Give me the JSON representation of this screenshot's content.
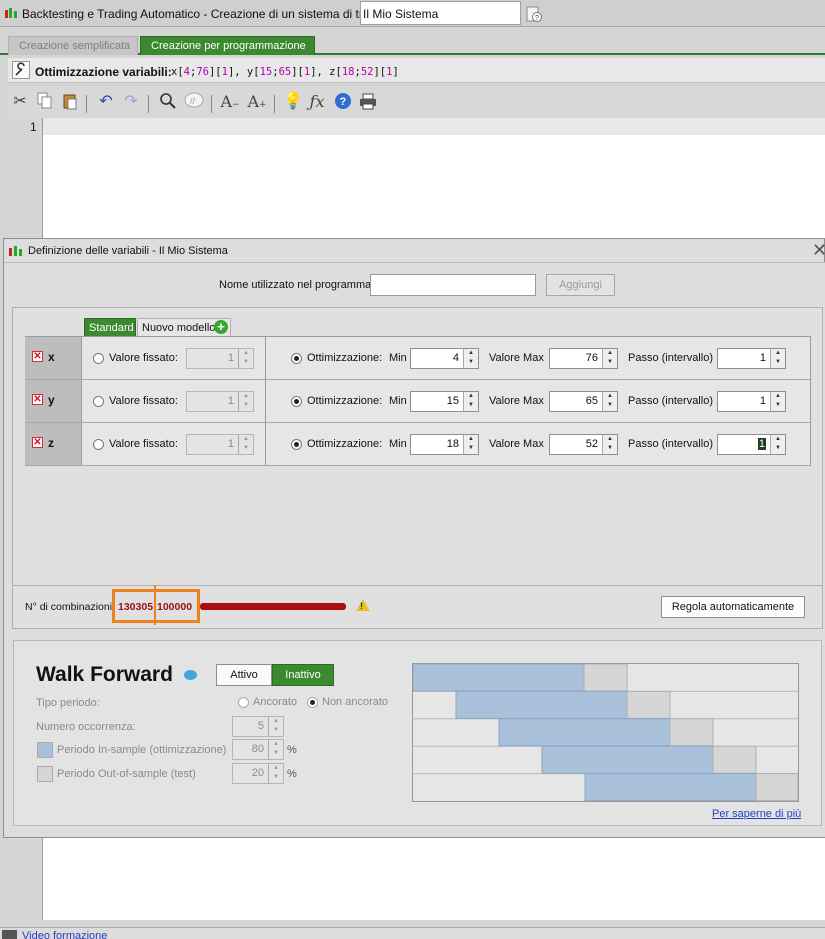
{
  "window": {
    "title": "Backtesting e Trading Automatico - Creazione di un sistema di trading",
    "system_name": "Il Mio Sistema"
  },
  "tabs": {
    "simple": "Creazione semplificata",
    "programming": "Creazione per programmazione"
  },
  "optimization": {
    "label": "Ottimizzazione variabili:",
    "vars": [
      {
        "name": "x",
        "min": "4",
        "max": "76",
        "step": "1"
      },
      {
        "name": "y",
        "min": "15",
        "max": "65",
        "step": "1"
      },
      {
        "name": "z",
        "min": "18",
        "max": "52",
        "step": "1"
      }
    ]
  },
  "editor": {
    "line_number": "1"
  },
  "dialog": {
    "title": "Definizione delle variabili - Il Mio Sistema",
    "name_label": "Nome utilizzato nel programma",
    "add_button": "Aggiungi",
    "tab_standard": "Standard",
    "tab_new_model": "Nuovo modello",
    "labels": {
      "fixed": "Valore fissato:",
      "optimization": "Ottimizzazione:",
      "min": "Min",
      "max": "Valore Max",
      "step": "Passo (intervallo)"
    },
    "rows": [
      {
        "name": "x",
        "fixed": "1",
        "min": "4",
        "max": "76",
        "step": "1"
      },
      {
        "name": "y",
        "fixed": "1",
        "min": "15",
        "max": "65",
        "step": "1"
      },
      {
        "name": "z",
        "fixed": "1",
        "min": "18",
        "max": "52",
        "step": "1"
      }
    ],
    "combinations_label": "N° di combinazioni",
    "combinations_value": "130305",
    "combinations_limit": "100000",
    "auto_button": "Regola automaticamente"
  },
  "walk_forward": {
    "title": "Walk Forward",
    "active": "Attivo",
    "inactive": "Inattivo",
    "period_type_label": "Tipo periodo:",
    "anchored": "Ancorato",
    "not_anchored": "Non ancorato",
    "occurrences_label": "Numero occorrenza:",
    "occurrences": "5",
    "in_sample_label": "Periodo In-sample (ottimizzazione)",
    "in_sample": "80",
    "out_sample_label": "Periodo Out-of-sample (test)",
    "out_sample": "20",
    "percent": "%",
    "learn_more": "Per saperne di più",
    "colors": {
      "in_sample": "#a9c1db",
      "out_sample": "#d6d6d6"
    }
  },
  "status": {
    "video_link": "Video formazione"
  },
  "colors": {
    "accent_green": "#3b8a2f",
    "warning_red": "#a80f0f",
    "highlight_orange": "#f07f1d"
  }
}
